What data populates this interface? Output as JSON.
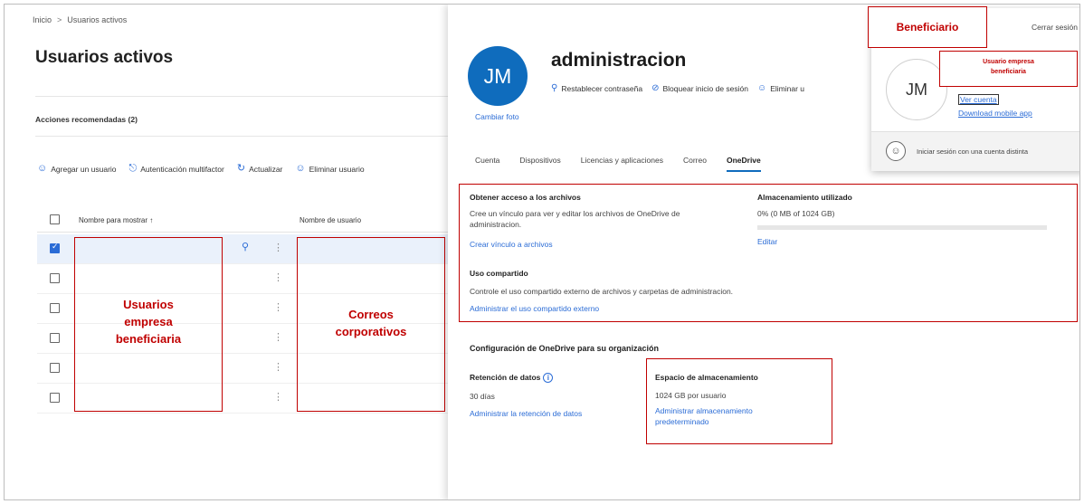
{
  "breadcrumb": {
    "home": "Inicio",
    "separator": ">",
    "current": "Usuarios activos"
  },
  "page_title": "Usuarios activos",
  "recommended_actions": "Acciones recomendadas (2)",
  "toolbar": {
    "add_user": "Agregar un usuario",
    "mfa": "Autenticación multifactor",
    "refresh": "Actualizar",
    "delete_user": "Eliminar usuario"
  },
  "grid": {
    "col_display_name": "Nombre para mostrar ↑",
    "col_username": "Nombre de usuario"
  },
  "annotations": {
    "users_box": [
      "Usuarios",
      "empresa",
      "beneficiaria"
    ],
    "emails_box": [
      "Correos",
      "corporativos"
    ],
    "beneficiary": "Beneficiario",
    "popup_user": [
      "Usuario empresa",
      "beneficiaria"
    ]
  },
  "panel": {
    "initials": "JM",
    "change_photo": "Cambiar foto",
    "title": "administracion",
    "actions": {
      "reset_password": "Restablecer contraseña",
      "block_signin": "Bloquear inicio de sesión",
      "delete": "Eliminar u"
    },
    "tabs": [
      "Cuenta",
      "Dispositivos",
      "Licencias y aplicaciones",
      "Correo",
      "OneDrive"
    ],
    "files": {
      "heading": "Obtener acceso a los archivos",
      "desc_line1": "Cree un vínculo para ver y editar los archivos de OneDrive de",
      "desc_line2": "administracion.",
      "link": "Crear vínculo a archivos"
    },
    "storage": {
      "heading": "Almacenamiento utilizado",
      "value": "0% (0 MB of 1024 GB)",
      "used_fraction": 0,
      "edit": "Editar"
    },
    "sharing": {
      "heading": "Uso compartido",
      "desc": "Controle el uso compartido externo de archivos y carpetas de administracion.",
      "link": "Administrar el uso compartido externo"
    },
    "org": {
      "heading": "Configuración de OneDrive para su organización",
      "retention_label": "Retención de datos",
      "retention_value": "30 días",
      "retention_link": "Administrar la retención de datos",
      "space_label": "Espacio de almacenamiento",
      "space_value": "1024 GB por usuario",
      "space_link_1": "Administrar almacenamiento",
      "space_link_2": "predeterminado"
    }
  },
  "popup": {
    "signout": "Cerrar sesión",
    "initials": "JM",
    "view_account": "Ver cuenta",
    "download_app": "Download mobile app",
    "other_account": "Iniciar sesión con una cuenta distinta"
  },
  "colors": {
    "accent": "#0f6cbd",
    "link": "#2b6cd6",
    "annotation": "#c00000"
  }
}
